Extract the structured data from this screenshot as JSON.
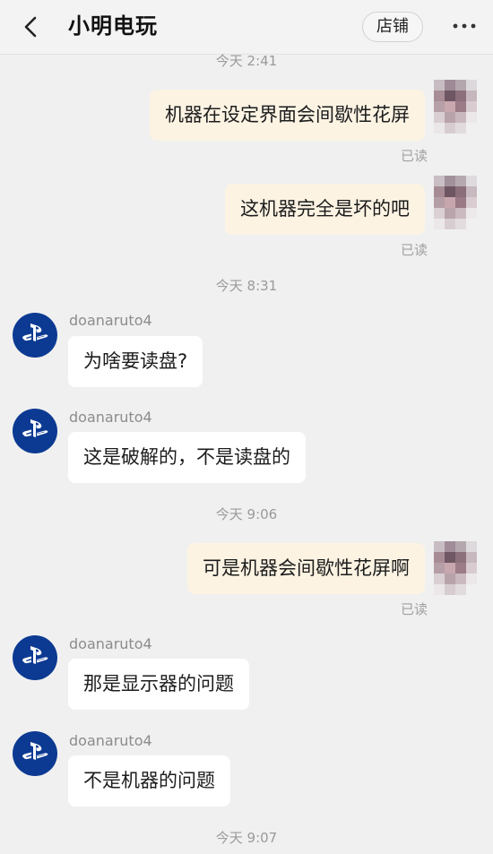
{
  "header": {
    "title": "小明电玩",
    "store_label": "店铺",
    "back_icon": "chevron-left-icon",
    "more_icon": "more-dots-icon"
  },
  "chat": {
    "timestamp_top": "今天 2:41",
    "timestamp_2": "今天 8:31",
    "timestamp_3": "今天 9:06",
    "timestamp_4": "今天 9:07",
    "read_label": "已读",
    "seller_name": "doanaruto4",
    "messages": [
      {
        "side": "right",
        "text": "机器在设定界面会间歇性花屏"
      },
      {
        "side": "right",
        "text": "这机器完全是坏的吧"
      },
      {
        "side": "left",
        "text": "为啥要读盘?"
      },
      {
        "side": "left",
        "text": "这是破解的，不是读盘的"
      },
      {
        "side": "right",
        "text": "可是机器会间歇性花屏啊"
      },
      {
        "side": "left",
        "text": "那是显示器的问题"
      },
      {
        "side": "left",
        "text": "不是机器的问题"
      }
    ]
  },
  "colors": {
    "background": "#f0f0f0",
    "right_bubble": "#fcf3e3",
    "left_bubble": "#ffffff",
    "seller_avatar": "#0c3a92"
  }
}
